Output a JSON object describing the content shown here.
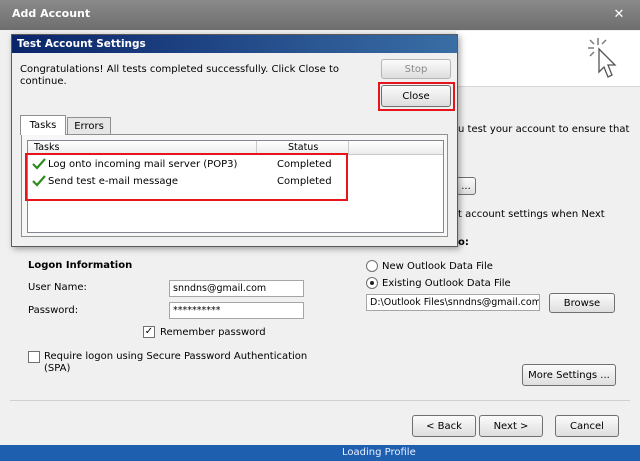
{
  "outer_window": {
    "title": "Add Account",
    "close_glyph": "✕",
    "partial_texts": {
      "line_test": "u test your account to ensure that",
      "line_next": "t account settings when Next",
      "line_colon": "o:"
    },
    "partial_button": "..."
  },
  "dialog": {
    "title": "Test Account Settings",
    "message": "Congratulations! All tests completed successfully. Click Close to continue.",
    "stop_label": "Stop",
    "close_label": "Close",
    "tabs": [
      {
        "label": "Tasks",
        "active": true
      },
      {
        "label": "Errors",
        "active": false
      }
    ],
    "columns": [
      "Tasks",
      "Status"
    ],
    "tasks": [
      {
        "name": "Log onto incoming mail server (POP3)",
        "status": "Completed",
        "icon": "check-icon"
      },
      {
        "name": "Send test e-mail message",
        "status": "Completed",
        "icon": "check-icon"
      }
    ]
  },
  "logon": {
    "section_title": "Logon Information",
    "user_name_label": "User Name:",
    "user_name_value": "snndns@gmail.com",
    "password_label": "Password:",
    "password_value": "**********",
    "remember_label": "Remember password",
    "remember_checked": true,
    "spa_label": "Require logon using Secure Password Authentication (SPA)",
    "spa_checked": false
  },
  "data_file": {
    "new_label": "New Outlook Data File",
    "existing_label": "Existing Outlook Data File",
    "existing_selected": true,
    "path_value": "D:\\Outlook Files\\snndns@gmail.com",
    "browse_label": "Browse"
  },
  "footer": {
    "more_settings_label": "More Settings ...",
    "back_label": "< Back",
    "next_label": "Next >",
    "cancel_label": "Cancel"
  },
  "taskbar": {
    "loading_text": "Loading Profile"
  },
  "colors": {
    "highlight_red": "#e8141b",
    "check_green": "#2e8b1e",
    "dialog_title_blue": "#0a246a"
  }
}
